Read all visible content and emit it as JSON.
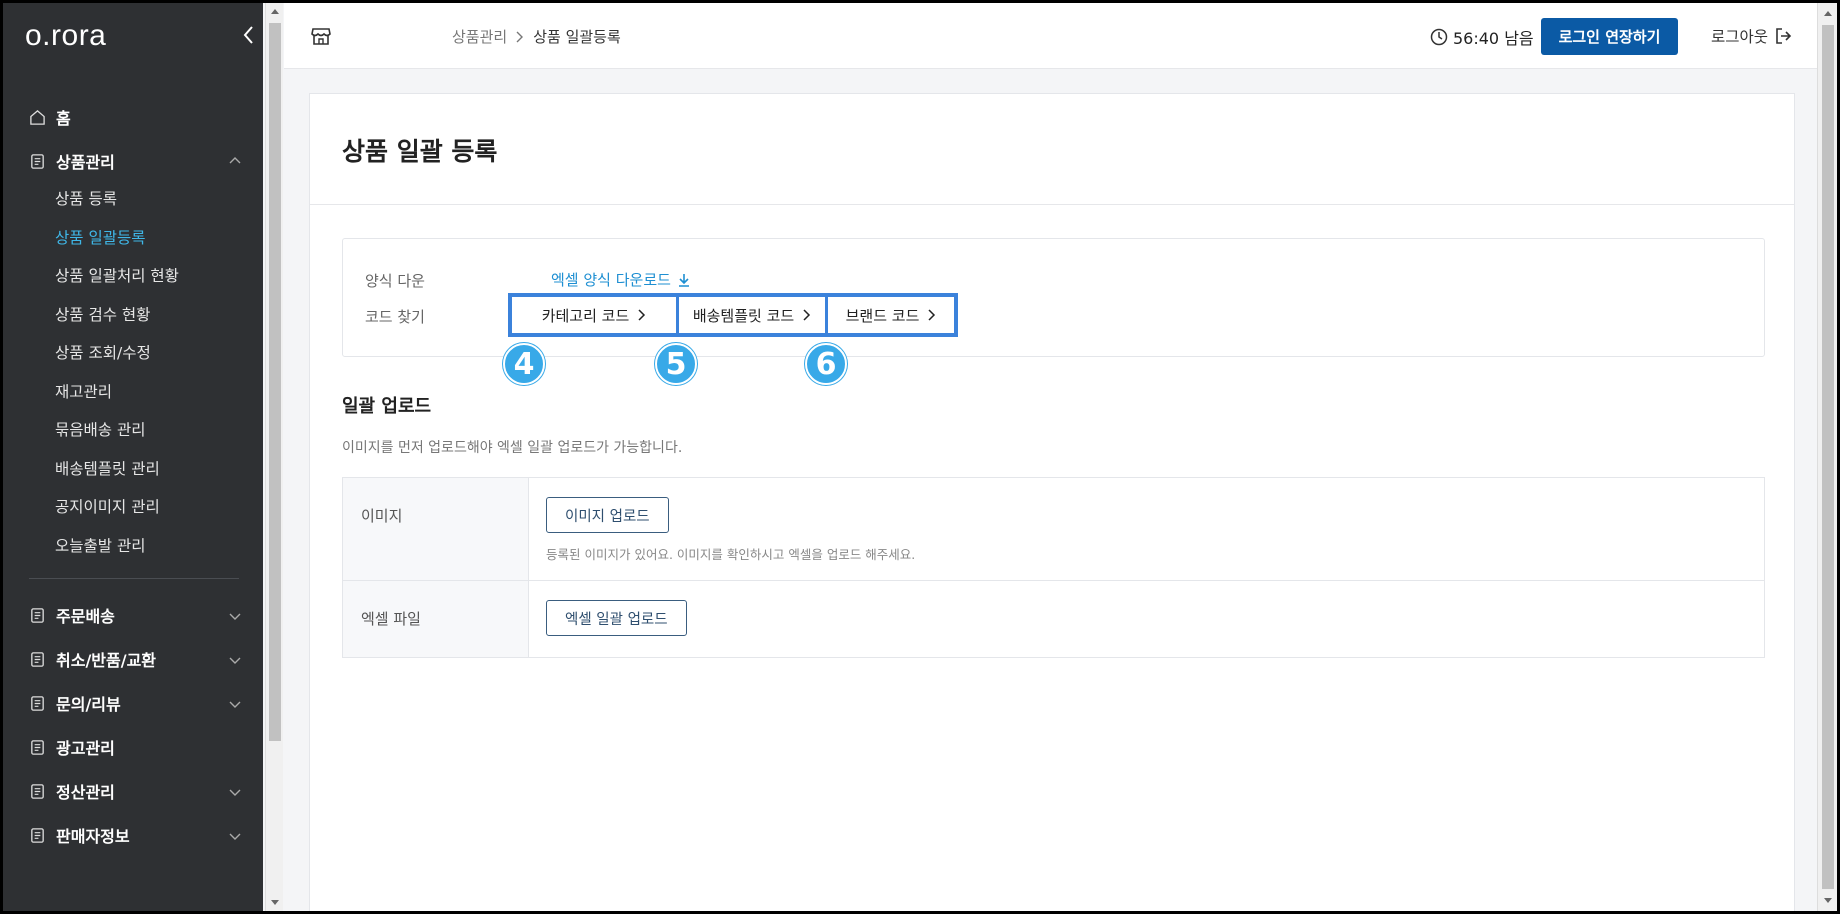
{
  "sidebar": {
    "logo": "o.rora",
    "home": "홈",
    "product_mgmt": "상품관리",
    "sub_items": [
      "상품 등록",
      "상품 일괄등록",
      "상품 일괄처리 현황",
      "상품 검수 현황",
      "상품 조회/수정",
      "재고관리",
      "묶음배송 관리",
      "배송템플릿 관리",
      "공지이미지 관리",
      "오늘출발 관리"
    ],
    "active_sub_index": 1,
    "sections": [
      "주문배송",
      "취소/반품/교환",
      "문의/리뷰",
      "광고관리",
      "정산관리",
      "판매자정보"
    ]
  },
  "header": {
    "breadcrumb_parent": "상품관리",
    "breadcrumb_current": "상품 일괄등록",
    "timer": "56:40 남음",
    "extend_login": "로그인 연장하기",
    "logout": "로그아웃"
  },
  "main": {
    "title": "상품 일괄 등록",
    "template_label": "양식 다운",
    "template_link": "엑셀 양식 다운로드",
    "code_label": "코드 찾기",
    "code_buttons": [
      "카테고리 코드",
      "배송템플릿 코드",
      "브랜드 코드"
    ],
    "badges": [
      "4",
      "5",
      "6"
    ],
    "upload_title": "일괄 업로드",
    "upload_desc": "이미지를 먼저 업로드해야 엑셀 일괄 업로드가 가능합니다.",
    "image_label": "이미지",
    "image_button": "이미지 업로드",
    "image_note": "등록된 이미지가 있어요. 이미지를 확인하시고 엑셀을 업로드 해주세요.",
    "excel_label": "엑셀 파일",
    "excel_button": "엑셀 일괄 업로드"
  },
  "colors": {
    "sidebar_bg": "#2e3033",
    "accent": "#3fb7e8",
    "primary": "#0b5aa5",
    "highlight": "#3b82db"
  }
}
